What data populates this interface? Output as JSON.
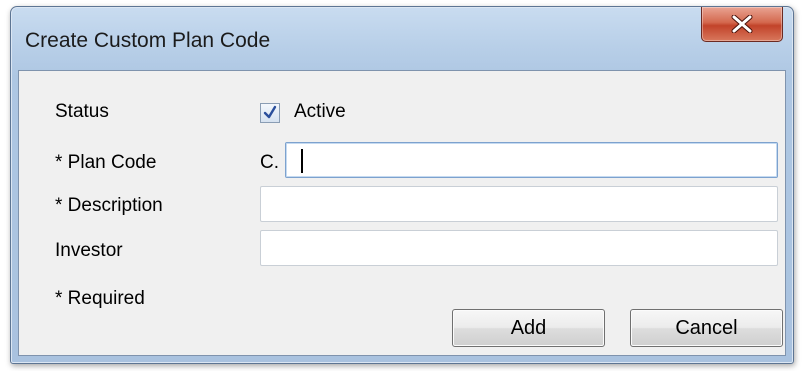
{
  "dialog": {
    "title": "Create Custom Plan Code"
  },
  "form": {
    "status_label": "Status",
    "active_label": "Active",
    "active_checked": true,
    "plan_code_label": "* Plan Code",
    "plan_code_prefix": "C.",
    "plan_code_value": "",
    "description_label": "* Description",
    "description_value": "",
    "investor_label": "Investor",
    "investor_value": "",
    "required_note": "* Required"
  },
  "buttons": {
    "add_label": "Add",
    "cancel_label": "Cancel"
  },
  "icons": {
    "close": "close-icon",
    "checkmark": "checkmark-icon"
  }
}
